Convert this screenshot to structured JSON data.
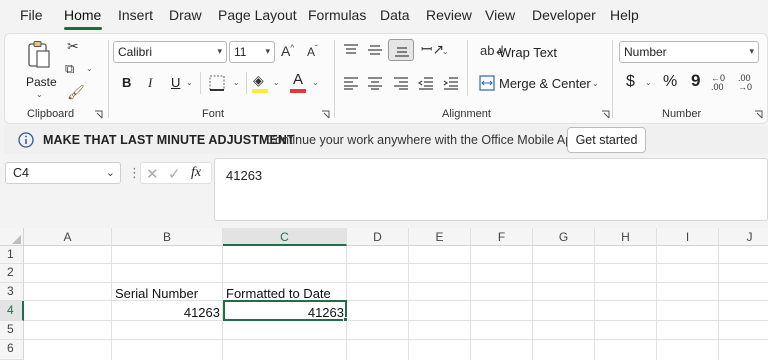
{
  "menu": {
    "tabs": [
      "File",
      "Home",
      "Insert",
      "Draw",
      "Page Layout",
      "Formulas",
      "Data",
      "Review",
      "View",
      "Developer",
      "Help"
    ],
    "active": "Home"
  },
  "ribbon": {
    "clipboard": {
      "paste_label": "Paste",
      "group_label": "Clipboard"
    },
    "font": {
      "font_name": "Calibri",
      "font_size": "11",
      "bold_label": "B",
      "italic_label": "I",
      "underline_label": "U",
      "grow_label": "A^",
      "shrink_label": "A˅",
      "group_label": "Font",
      "fill_color": "#ffeb3b",
      "font_color": "#e53935"
    },
    "alignment": {
      "wrap_text_label": "Wrap Text",
      "merge_center_label": "Merge & Center",
      "group_label": "Alignment"
    },
    "number": {
      "format_value": "Number",
      "currency_symbol": "$",
      "percent_symbol": "%",
      "comma_symbol": "9",
      "group_label": "Number"
    }
  },
  "message_bar": {
    "title": "MAKE THAT LAST MINUTE ADJUSTMENT",
    "text": "Continue your work anywhere with the Office Mobile App",
    "button_label": "Get started"
  },
  "formula_bar": {
    "name_box": "C4",
    "fx_label": "fx",
    "formula": "41263"
  },
  "sheet": {
    "columns": [
      "A",
      "B",
      "C",
      "D",
      "E",
      "F",
      "G",
      "H",
      "I",
      "J"
    ],
    "rows": [
      "1",
      "2",
      "3",
      "4",
      "5",
      "6"
    ],
    "selected_cell": "C4",
    "cells": {
      "B3": "Serial Number",
      "C3": "Formatted to Date",
      "B4": "41263",
      "C4": "41263"
    }
  },
  "colors": {
    "accent": "#1e7145",
    "ribbon_bg": "#fbfbfb",
    "window_bg": "#f3f3f3"
  }
}
